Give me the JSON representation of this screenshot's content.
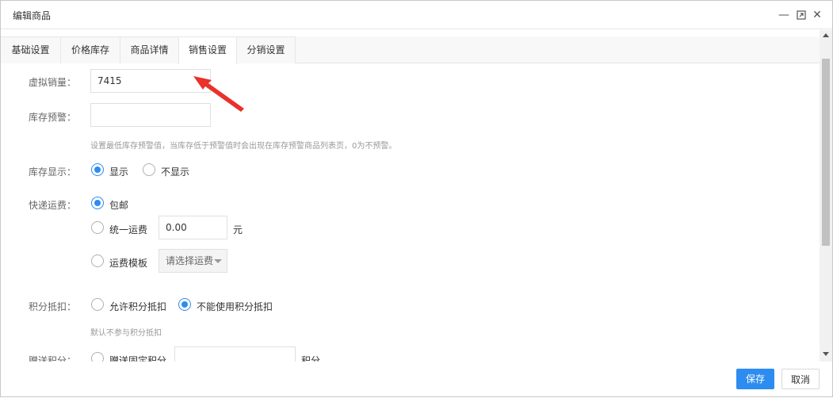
{
  "window": {
    "title": "编辑商品"
  },
  "tabs": [
    "基础设置",
    "价格库存",
    "商品详情",
    "销售设置",
    "分销设置"
  ],
  "form": {
    "virtual_sales": {
      "label": "虚拟销量：",
      "value": "7415"
    },
    "stock_warning": {
      "label": "库存预警：",
      "value": "",
      "hint": "设置最低库存预警值，当库存低于预警值时会出现在库存预警商品列表页，0为不预警。"
    },
    "stock_display": {
      "label": "库存显示：",
      "options": [
        "显示",
        "不显示"
      ],
      "selected": "显示"
    },
    "shipping": {
      "label": "快递运费：",
      "free": "包邮",
      "unified": "统一运费",
      "unified_value": "0.00",
      "unit": "元",
      "template": "运费模板",
      "template_placeholder": "请选择运费",
      "selected": "包邮"
    },
    "points_deduct": {
      "label": "积分抵扣：",
      "options": [
        "允许积分抵扣",
        "不能使用积分抵扣"
      ],
      "selected": "不能使用积分抵扣",
      "hint": "默认不参与积分抵扣"
    },
    "gift_points": {
      "label": "赠送积分：",
      "option": "赠送固定积分",
      "unit": "积分",
      "value": ""
    }
  },
  "footer": {
    "save": "保存",
    "cancel": "取消"
  },
  "colors": {
    "accent": "#2d8cf0",
    "annotation_arrow": "#e8322a"
  },
  "icons": [
    "minimize-icon",
    "maximize-icon",
    "close-icon",
    "annotation-arrow"
  ]
}
